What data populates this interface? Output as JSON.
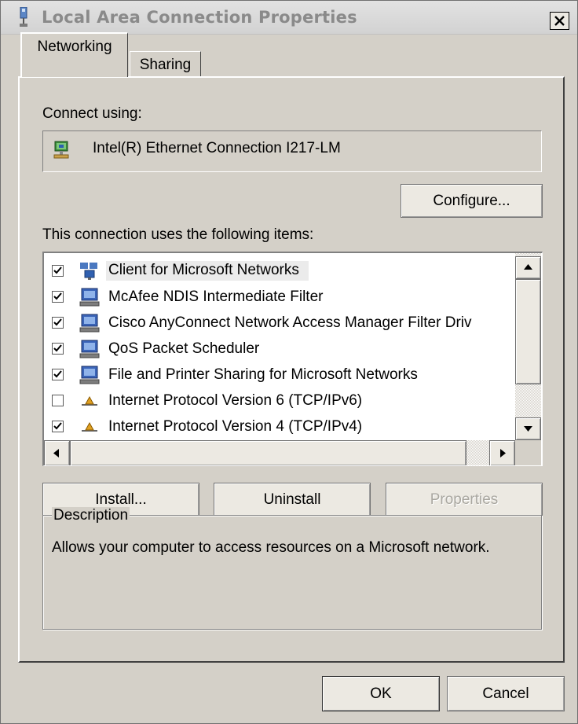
{
  "window": {
    "title": "Local Area Connection Properties",
    "close_glyph": "X"
  },
  "tabs": [
    {
      "label": "Networking"
    },
    {
      "label": "Sharing"
    }
  ],
  "connect_using": {
    "label": "Connect using:",
    "adapter": "Intel(R) Ethernet Connection I217-LM",
    "adapter_icon": "network-adapter-icon"
  },
  "configure_label": "Configure...",
  "items_label": "This connection uses the following items:",
  "items": [
    {
      "label": "Client for Microsoft Networks",
      "checked": true,
      "icon": "network-client-icon",
      "selected": true
    },
    {
      "label": "McAfee NDIS Intermediate Filter",
      "checked": true,
      "icon": "network-service-icon"
    },
    {
      "label": "Cisco AnyConnect Network Access Manager Filter Driv",
      "checked": true,
      "icon": "network-service-icon"
    },
    {
      "label": "QoS Packet Scheduler",
      "checked": true,
      "icon": "network-service-icon"
    },
    {
      "label": "File and Printer Sharing for Microsoft Networks",
      "checked": true,
      "icon": "network-service-icon"
    },
    {
      "label": "Internet Protocol Version 6 (TCP/IPv6)",
      "checked": false,
      "icon": "protocol-icon"
    },
    {
      "label": "Internet Protocol Version 4 (TCP/IPv4)",
      "checked": true,
      "icon": "protocol-icon"
    }
  ],
  "buttons": {
    "install": "Install...",
    "uninstall": "Uninstall",
    "properties": "Properties",
    "ok": "OK",
    "cancel": "Cancel"
  },
  "description": {
    "legend": "Description",
    "text": "Allows your computer to access resources on a Microsoft network."
  },
  "colors": {
    "dialog_bg": "#d4d0c8",
    "title_text": "#8a8a8a",
    "disabled_text": "#a9a7a0"
  }
}
